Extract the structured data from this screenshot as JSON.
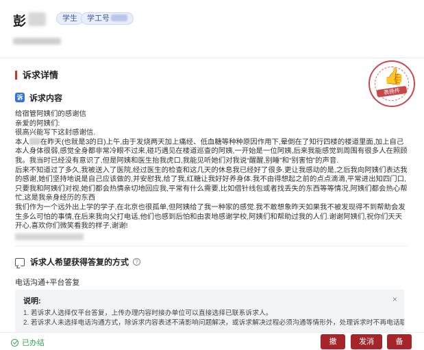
{
  "header": {
    "name_char": "彭",
    "tags": [
      "学生",
      "学工号"
    ]
  },
  "section": {
    "title": "诉求详情",
    "stamp_text": "表扬件"
  },
  "content_section": {
    "icon_char": "诉",
    "label": "诉求内容",
    "paragraphs": [
      "给宿管阿姨们的感谢信",
      "亲爱的阿姨们:",
      "很高兴能写下这封感谢信.",
      "在昨天(也就是3的日)上午,由于发烧两天加上痛经、低血糖等种种原因作用下,晕倒在了知行四楼的楼道里面,加上自己本人身体很弱,感觉全身都非常冷眼不过来,碰巧遇见在楼道巡查的阿姨,一开始是一位阿姨,后来我能感觉到周围有很多人在照顾我。我当时已经没有意识了,但是阿姨和医生抬我虎口,我能见听她们对我说“醒醒,别睡”和“别害怕”的声音.",
      "后来不知道过了多久,我被送入了医院,经过医生的检查和这几天的休息我已经好了很多.更让我感动的是,之后我向阿姨们表达我的感谢,她们坚持地说是自己应该做的,并安慰我,给了我,红糖让我好好养身体.我不由得想起之前的点点滴滴,平常进出知四门口,只要我和阿姨们对视,她们都会热情亲切地回应我,平常有什么需要,比如借针线包或者找丢失的东西等等情况,阿姨们都会热心帮忙,这是我亲身经历的东西",
      "我们作为一个远外出上学的学子,在北京也很孤单,但阿姨给了我一种家的感觉.我不敢想象昨天如果我不被发现得不到帮助会发生多么可怕的事情,在后来我向父打电话,他们也感到后怕和由衷地感谢学校,阿姨们和帮助过我的人们.谢谢阿姨们,祝你们天天开心,喜欢你们微笑看我的样子,谢谢!"
    ],
    "para4_prefix": "本人"
  },
  "option_section": {
    "label": "诉求人希望获得答复的方式",
    "value": "电话沟通+平台答复"
  },
  "note": {
    "title": "说明:",
    "lines": [
      "1. 若诉求人选择仅平台答复，上传办理内容时接办单位可以直接选择已联系诉求人。",
      "2. 若诉求人未选择电话沟通方式，除诉求内容表述不清影响问题解决，或诉求解决过程必须沟通等情形外，处理诉求时不再电话联系诉求人。"
    ],
    "close": "×"
  },
  "footer": {
    "status": "已办结",
    "buttons": {
      "withdraw": "撤销",
      "message": "发消息",
      "remark": "备注"
    }
  },
  "colors": {
    "accent": "#a5252a",
    "stamp": "#c9474b",
    "status_green": "#3aa757",
    "icon_blue": "#2f72e4"
  }
}
